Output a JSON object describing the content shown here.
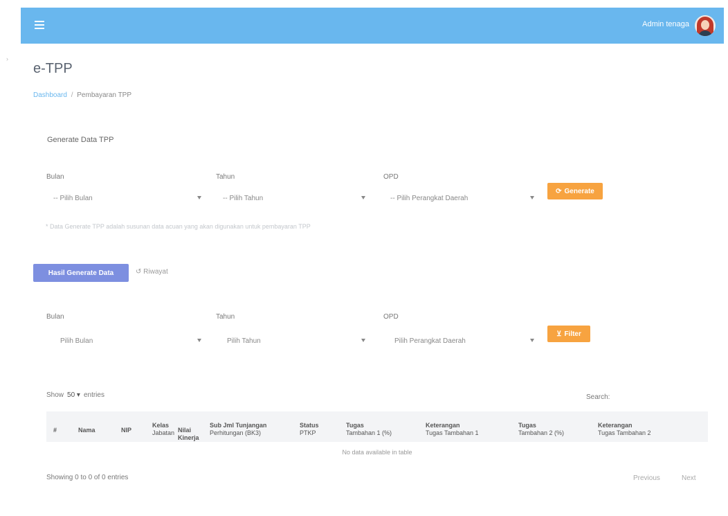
{
  "topbar": {
    "user_name": "Admin tenaga",
    "menu_icon": "menu-icon",
    "color": "#69b7ee"
  },
  "page": {
    "title": "e-TPP",
    "breadcrumb": {
      "home": "Dashboard",
      "current": "Pembayaran TPP"
    }
  },
  "generate": {
    "section_title": "Generate Data TPP",
    "bulan_label": "Bulan",
    "tahun_label": "Tahun",
    "opd_label": "OPD",
    "bulan_value": "-- Pilih Bulan",
    "tahun_value": "-- Pilih Tahun",
    "opd_value": "-- Pilih Perangkat Daerah",
    "button_label": "Generate",
    "button_icon": "refresh-icon",
    "hint": "* Data Generate TPP adalah susunan data acuan yang akan digunakan untuk pembayaran TPP"
  },
  "tabs": {
    "active": "Hasil Generate Data",
    "other": "Riwayat"
  },
  "filter": {
    "bulan_label": "Bulan",
    "tahun_label": "Tahun",
    "opd_label": "OPD",
    "bulan_value": "Pilih Bulan",
    "tahun_value": "Pilih Tahun",
    "opd_value": "Pilih Perangkat Daerah",
    "button_label": "Filter",
    "button_icon": "filter-icon"
  },
  "table": {
    "show": "Show",
    "length": "50",
    "entries": "entries",
    "search_label": "Search:",
    "columns": [
      {
        "main": "#",
        "sub": ""
      },
      {
        "main": "Nama",
        "sub": ""
      },
      {
        "main": "NIP",
        "sub": ""
      },
      {
        "main": "Kelas",
        "sub": "Jabatan"
      },
      {
        "main": "Nilai Kinerja",
        "sub": ""
      },
      {
        "main": "Sub Jml Tunjangan",
        "sub": "Perhitungan (BK3)"
      },
      {
        "main": "Status",
        "sub": "PTKP"
      },
      {
        "main": "Tugas",
        "sub": "Tambahan 1 (%)"
      },
      {
        "main": "Keterangan",
        "sub": "Tugas Tambahan 1"
      },
      {
        "main": "Tugas",
        "sub": "Tambahan 2 (%)"
      },
      {
        "main": "Keterangan",
        "sub": "Tugas Tambahan 2"
      }
    ],
    "empty": "No data available in table",
    "info": "Showing 0 to 0 of 0 entries",
    "prev": "Previous",
    "next": "Next"
  }
}
